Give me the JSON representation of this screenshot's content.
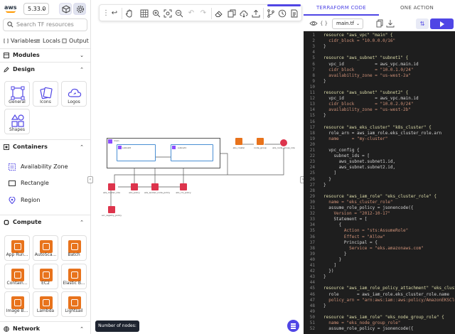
{
  "sidebar": {
    "logo_text": "aws",
    "version": "5.33.0",
    "search_placeholder": "Search TF resources",
    "tabs": [
      "Variables",
      "Locals",
      "Output"
    ],
    "sections": {
      "modules": "Modules",
      "design": "Design",
      "containers": "Containers",
      "compute": "Compute",
      "network": "Network"
    },
    "design_items": [
      "General",
      "Icons",
      "Logos",
      "Shapes"
    ],
    "container_items": [
      "Availability Zone",
      "Rectangle",
      "Region"
    ],
    "compute_items": [
      "App Run...",
      "AutoSca...",
      "Batch",
      "Contain...",
      "EC2",
      "Elastic B...",
      "Image B...",
      "Lambda",
      "Lightsail"
    ]
  },
  "toolbar": {
    "icons": [
      "drag-handle-icon",
      "back-arrow-icon",
      "hand-icon",
      "grid-icon",
      "zoom-in-icon",
      "fit-screen-icon",
      "zoom-out-icon",
      "undo-icon",
      "redo-icon",
      "eraser-icon",
      "copy-icon",
      "cloud-download-icon",
      "upload-icon",
      "branch-icon",
      "history-icon",
      "document-icon",
      "more-icon"
    ]
  },
  "canvas": {
    "vpc_label": "main",
    "subnet1_label": "subnet2",
    "subnet2_label": "subnet1",
    "nodes": [
      {
        "label": "eks_cluster",
        "color": "#e8731c"
      },
      {
        "label": "node_group",
        "color": "#e8731c"
      },
      {
        "label": "eks_node_group_role",
        "color": "#dd344c"
      },
      {
        "label": "eks_cluster_role",
        "color": "#dd344c"
      },
      {
        "label": "eks_policy",
        "color": "#dd344c"
      },
      {
        "label": "eks_worker_node_policy",
        "color": "#dd344c"
      },
      {
        "label": "eks_cni_policy",
        "color": "#dd344c"
      },
      {
        "label": "ecr_registry_policy",
        "color": "#dd344c"
      }
    ],
    "node_count_label": "Number of nodes: 11"
  },
  "right_panel": {
    "tabs": [
      "TERRAFORM CODE",
      "ONE ACTION"
    ],
    "file_name": "main.tf",
    "accent_color": "#4f46e5",
    "code_lines": [
      "resource \"aws_vpc\" \"main\" {",
      "  cidr_block = \"10.0.0.0/16\"",
      "}",
      "",
      "resource \"aws_subnet\" \"subnet1\" {",
      "  vpc_id            = aws_vpc.main.id",
      "  cidr_block        = \"10.0.1.0/24\"",
      "  availability_zone = \"us-west-2a\"",
      "}",
      "",
      "resource \"aws_subnet\" \"subnet2\" {",
      "  vpc_id            = aws_vpc.main.id",
      "  cidr_block        = \"10.0.2.0/24\"",
      "  availability_zone = \"us-west-2b\"",
      "}",
      "",
      "resource \"aws_eks_cluster\" \"k8s_cluster\" {",
      "  role_arn = aws_iam_role.eks_cluster_role.arn",
      "  name     = \"my-cluster\"",
      "",
      "  vpc_config {",
      "    subnet_ids = [",
      "      aws_subnet.subnet1.id,",
      "      aws_subnet.subnet2.id,",
      "    ]",
      "  }",
      "}",
      "",
      "resource \"aws_iam_role\" \"eks_cluster_role\" {",
      "  name = \"eks_cluster_role\"",
      "  assume_role_policy = jsonencode({",
      "    Version = \"2012-10-17\"",
      "    Statement = [",
      "      {",
      "        Action = \"sts:AssumeRole\"",
      "        Effect = \"Allow\"",
      "        Principal = {",
      "          Service = \"eks.amazonaws.com\"",
      "        }",
      "      }",
      "    ]",
      "  })",
      "}",
      "",
      "resource \"aws_iam_role_policy_attachment\" \"eks_cluster_po",
      "  role       = aws_iam_role.eks_cluster_role.name",
      "  policy_arn = \"arn:aws:iam::aws:policy/AmazonEKSClusterP",
      "}",
      "",
      "resource \"aws_iam_role\" \"eks_node_group_role\" {",
      "  name = \"eks_node_group_role\"",
      "  assume_role_policy = jsonencode({"
    ]
  }
}
